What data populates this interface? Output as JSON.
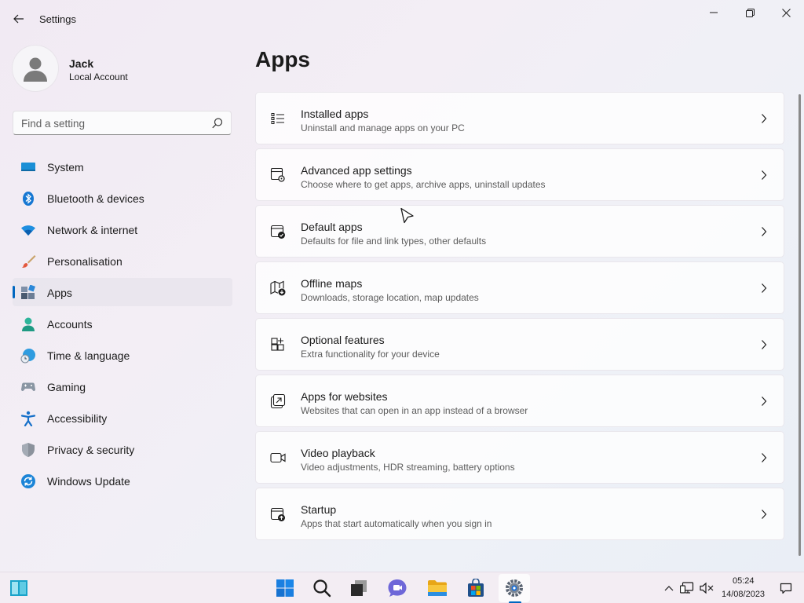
{
  "window": {
    "title": "Settings",
    "controls": [
      "minimize",
      "maximize",
      "close"
    ]
  },
  "profile": {
    "name": "Jack",
    "account_type": "Local Account"
  },
  "search": {
    "placeholder": "Find a setting"
  },
  "sidebar": {
    "items": [
      {
        "label": "System",
        "icon": "system-icon",
        "active": false
      },
      {
        "label": "Bluetooth & devices",
        "icon": "bluetooth-icon",
        "active": false
      },
      {
        "label": "Network & internet",
        "icon": "wifi-icon",
        "active": false
      },
      {
        "label": "Personalisation",
        "icon": "brush-icon",
        "active": false
      },
      {
        "label": "Apps",
        "icon": "apps-icon",
        "active": true
      },
      {
        "label": "Accounts",
        "icon": "accounts-icon",
        "active": false
      },
      {
        "label": "Time & language",
        "icon": "clock-globe-icon",
        "active": false
      },
      {
        "label": "Gaming",
        "icon": "gamepad-icon",
        "active": false
      },
      {
        "label": "Accessibility",
        "icon": "accessibility-icon",
        "active": false
      },
      {
        "label": "Privacy & security",
        "icon": "shield-icon",
        "active": false
      },
      {
        "label": "Windows Update",
        "icon": "update-icon",
        "active": false
      }
    ]
  },
  "main": {
    "title": "Apps",
    "cards": [
      {
        "title": "Installed apps",
        "description": "Uninstall and manage apps on your PC",
        "icon": "list-icon"
      },
      {
        "title": "Advanced app settings",
        "description": "Choose where to get apps, archive apps, uninstall updates",
        "icon": "app-settings-icon"
      },
      {
        "title": "Default apps",
        "description": "Defaults for file and link types, other defaults",
        "icon": "default-apps-icon"
      },
      {
        "title": "Offline maps",
        "description": "Downloads, storage location, map updates",
        "icon": "map-download-icon"
      },
      {
        "title": "Optional features",
        "description": "Extra functionality for your device",
        "icon": "add-feature-icon"
      },
      {
        "title": "Apps for websites",
        "description": "Websites that can open in an app instead of a browser",
        "icon": "open-external-icon"
      },
      {
        "title": "Video playback",
        "description": "Video adjustments, HDR streaming, battery options",
        "icon": "video-camera-icon"
      },
      {
        "title": "Startup",
        "description": "Apps that start automatically when you sign in",
        "icon": "startup-icon"
      }
    ]
  },
  "taskbar": {
    "apps": [
      "widgets",
      "start",
      "search",
      "task-view",
      "chat",
      "file-explorer",
      "store",
      "settings"
    ],
    "active_app": "settings",
    "time": "05:24",
    "date": "14/08/2023"
  },
  "colors": {
    "accent": "#0067c0",
    "background": "#f1ecf4"
  }
}
